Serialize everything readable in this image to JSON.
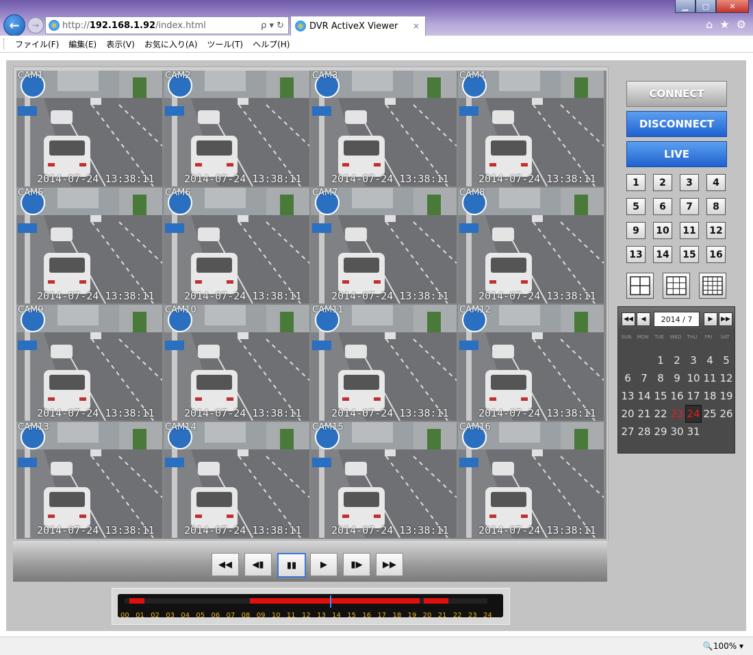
{
  "browser": {
    "url_prefix": "http://",
    "url_host": "192.168.1.92",
    "url_path": "/index.html",
    "tab_title": "DVR ActiveX Viewer",
    "search_symbol": "ρ ▾ ↻",
    "tab_close": "×",
    "status_zoom": "🔍100%  ▾"
  },
  "menu": [
    "ファイル(F)",
    "編集(E)",
    "表示(V)",
    "お気に入り(A)",
    "ツール(T)",
    "ヘルプ(H)"
  ],
  "cameras": [
    {
      "label": "CAM1",
      "timestamp": "2014-07-24 13:38:11"
    },
    {
      "label": "CAM2",
      "timestamp": "2014-07-24 13:38:11"
    },
    {
      "label": "CAM3",
      "timestamp": "2014-07-24 13:38:11"
    },
    {
      "label": "CAM4",
      "timestamp": "2014-07-24 13:38:11"
    },
    {
      "label": "CAM5",
      "timestamp": "2014-07-24 13:38:11"
    },
    {
      "label": "CAM6",
      "timestamp": "2014-07-24 13:38:11"
    },
    {
      "label": "CAM7",
      "timestamp": "2014-07-24 13:38:11"
    },
    {
      "label": "CAM8",
      "timestamp": "2014-07-24 13:38:11"
    },
    {
      "label": "CAM9",
      "timestamp": "2014-07-24 13:38:11"
    },
    {
      "label": "CAM10",
      "timestamp": "2014-07-24 13:38:11"
    },
    {
      "label": "CAM11",
      "timestamp": "2014-07-24 13:38:11"
    },
    {
      "label": "CAM12",
      "timestamp": "2014-07-24 13:38:11"
    },
    {
      "label": "CAM13",
      "timestamp": "2014-07-24 13:38:11"
    },
    {
      "label": "CAM14",
      "timestamp": "2014-07-24 13:38:11"
    },
    {
      "label": "CAM15",
      "timestamp": "2014-07-24 13:38:11"
    },
    {
      "label": "CAM16",
      "timestamp": "2014-07-24 13:38:11"
    }
  ],
  "selected_camera": 1,
  "controls": {
    "connect": "CONNECT",
    "disconnect": "DISCONNECT",
    "live": "LIVE",
    "channels": [
      "1",
      "2",
      "3",
      "4",
      "5",
      "6",
      "7",
      "8",
      "9",
      "10",
      "11",
      "12",
      "13",
      "14",
      "15",
      "16"
    ]
  },
  "playback": [
    "◀◀",
    "◀▮",
    "▮▮",
    "▶",
    "▮▶",
    "▶▶"
  ],
  "timeline": {
    "hours": [
      "00",
      "01",
      "02",
      "03",
      "04",
      "05",
      "06",
      "07",
      "08",
      "09",
      "10",
      "11",
      "12",
      "13",
      "14",
      "15",
      "16",
      "17",
      "18",
      "19",
      "20",
      "21",
      "22",
      "23",
      "24"
    ],
    "recorded_segments": [
      [
        0.3,
        1.3
      ],
      [
        8.3,
        19.5
      ],
      [
        19.8,
        21.4
      ]
    ],
    "cursor_hour": 13.6
  },
  "calendar": {
    "month_label": "2014 / 7",
    "weekdays": [
      "SUN",
      "MON",
      "TUE",
      "WED",
      "THU",
      "FRI",
      "SAT"
    ],
    "first_weekday": 2,
    "days_in_month": 31,
    "recorded_day": 23,
    "selected_day": 24
  },
  "colors": {
    "accent_blue": "#1f62d0",
    "record_red": "#e01010",
    "cursor_blue": "#3a8cff"
  }
}
